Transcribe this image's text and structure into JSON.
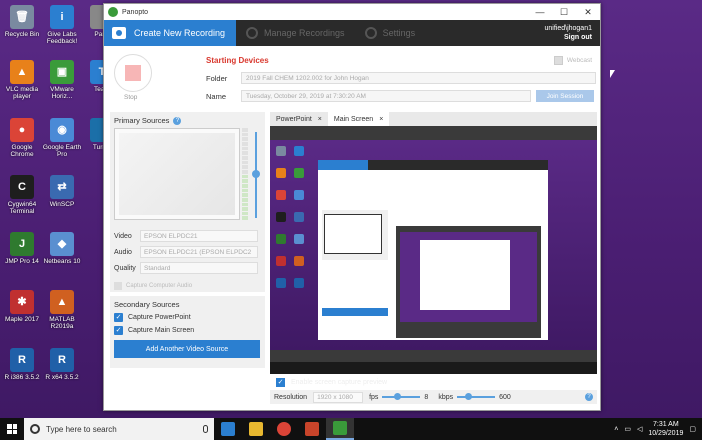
{
  "desktop": {
    "icons": [
      {
        "label": "Recycle Bin",
        "color": "#7a8aa0",
        "glyph": "🗑"
      },
      {
        "label": "Give Labs Feedback!",
        "color": "#2b7fd0",
        "glyph": "i"
      },
      {
        "label": "Pano",
        "color": "#888",
        "glyph": ""
      },
      {
        "label": "VLC media player",
        "color": "#e8811a",
        "glyph": "▲"
      },
      {
        "label": "VMware Horiz...",
        "color": "#3a9b3a",
        "glyph": "▣"
      },
      {
        "label": "Team",
        "color": "#2b7fd0",
        "glyph": "T"
      },
      {
        "label": "Google Chrome",
        "color": "#db4437",
        "glyph": "●"
      },
      {
        "label": "Google Earth Pro",
        "color": "#4a8ad6",
        "glyph": "◉"
      },
      {
        "label": "Turnin",
        "color": "#1b6fa8",
        "glyph": ""
      },
      {
        "label": "Cygwin64 Terminal",
        "color": "#1e1e1e",
        "glyph": "C"
      },
      {
        "label": "WinSCP",
        "color": "#3a6ab0",
        "glyph": "⇄"
      },
      {
        "label": "JMP Pro 14",
        "color": "#2f7a2f",
        "glyph": "J"
      },
      {
        "label": "Netbeans 10",
        "color": "#5a8fd0",
        "glyph": "◆"
      },
      {
        "label": "Maple 2017",
        "color": "#c03030",
        "glyph": "✱"
      },
      {
        "label": "MATLAB R2019a",
        "color": "#d06020",
        "glyph": "▲"
      },
      {
        "label": "R i386 3.5.2",
        "color": "#2060a8",
        "glyph": "R"
      },
      {
        "label": "R x64 3.5.2",
        "color": "#2060a8",
        "glyph": "R"
      }
    ]
  },
  "window": {
    "title": "Panopto",
    "minimize": "—",
    "maximize": "☐",
    "close": "✕"
  },
  "topbar": {
    "create_tab": "Create New Recording",
    "manage_tab": "Manage Recordings",
    "settings_tab": "Settings",
    "username": "unified\\jhogan1",
    "signout": "Sign out"
  },
  "recording": {
    "stop_label": "Stop",
    "status": "Starting Devices",
    "folder_label": "Folder",
    "folder_value": "2019 Fall CHEM 1202.002 for John Hogan",
    "name_label": "Name",
    "name_value": "Tuesday, October 29, 2019 at 7:30:20 AM",
    "webcast_label": "Webcast",
    "join_button": "Join Session"
  },
  "primary_sources": {
    "title": "Primary Sources",
    "video_label": "Video",
    "video_value": "EPSON ELPDC21",
    "audio_label": "Audio",
    "audio_value": "EPSON ELPDC21 (EPSON ELPDC2",
    "quality_label": "Quality",
    "quality_value": "Standard",
    "capture_label": "Capture Computer Audio"
  },
  "secondary_sources": {
    "title": "Secondary Sources",
    "capture_powerpoint": "Capture PowerPoint",
    "capture_main_screen": "Capture Main Screen",
    "add_button": "Add Another Video Source"
  },
  "preview": {
    "tab_powerpoint": "PowerPoint",
    "tab_main_screen": "Main Screen",
    "tab_close": "×",
    "enable_label": "Enable screen capture preview",
    "resolution_label": "Resolution",
    "resolution_value": "1920 x 1080",
    "fps_label": "fps",
    "fps_value": "8",
    "fps_level": 0.3,
    "kbps_label": "kbps",
    "kbps_value": "600",
    "kbps_level": 0.2
  },
  "taskbar": {
    "search_placeholder": "Type here to search",
    "time": "7:31 AM",
    "date": "10/29/2019"
  },
  "colors": {
    "accent": "#2b7fd0",
    "status_red": "#d9382e",
    "desktop": "#5a2a86"
  }
}
